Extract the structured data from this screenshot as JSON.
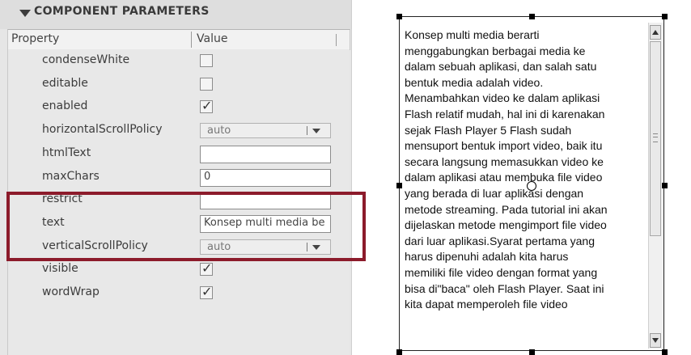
{
  "panel": {
    "title": "COMPONENT PARAMETERS",
    "columns": {
      "property": "Property",
      "value": "Value"
    },
    "rows": [
      {
        "label": "condenseWhite",
        "kind": "checkbox",
        "checked": false
      },
      {
        "label": "editable",
        "kind": "checkbox",
        "checked": false
      },
      {
        "label": "enabled",
        "kind": "checkbox",
        "checked": true
      },
      {
        "label": "horizontalScrollPolicy",
        "kind": "select",
        "value": "auto"
      },
      {
        "label": "htmlText",
        "kind": "text",
        "value": ""
      },
      {
        "label": "maxChars",
        "kind": "text",
        "value": "0"
      },
      {
        "label": "restrict",
        "kind": "text",
        "value": ""
      },
      {
        "label": "text",
        "kind": "text",
        "value": "Konsep multi media be"
      },
      {
        "label": "verticalScrollPolicy",
        "kind": "select",
        "value": "auto"
      },
      {
        "label": "visible",
        "kind": "checkbox",
        "checked": true
      },
      {
        "label": "wordWrap",
        "kind": "checkbox",
        "checked": true
      }
    ],
    "check_glyph": "☑",
    "highlight_color": "#8c1b2b"
  },
  "textarea": {
    "lines": [
      "Konsep multi media berarti",
      "menggabungkan berbagai media ke",
      "dalam sebuah aplikasi, dan salah satu",
      "bentuk media adalah video.",
      "Menambahkan video ke dalam aplikasi",
      "Flash relatif mudah, hal ini di karenakan",
      "sejak Flash Player 5 Flash sudah",
      "mensuport bentuk import video, baik itu",
      "secara langsung memasukkan video ke",
      "dalam aplikasi atau membuka file video",
      "yang berada di luar aplikasi dengan",
      "metode streaming. Pada tutorial ini akan",
      "dijelaskan metode mengimport file video",
      "dari luar aplikasi.Syarat pertama yang",
      "harus dipenuhi adalah kita harus",
      "memiliki file video dengan format yang",
      "bisa di\"baca\" oleh Flash Player. Saat ini",
      "kita dapat memperoleh file video"
    ]
  }
}
